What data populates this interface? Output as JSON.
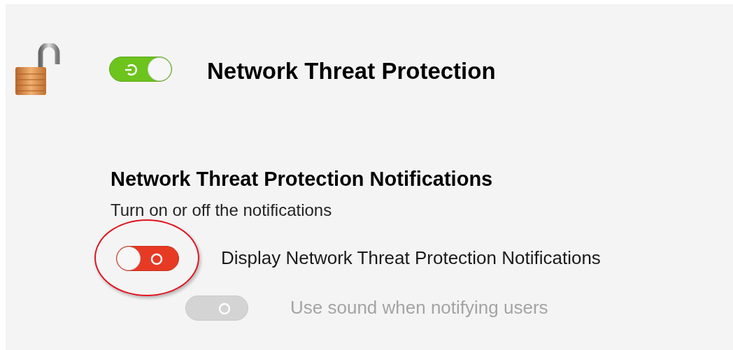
{
  "main_setting": {
    "label": "Network Threat Protection",
    "toggle": {
      "on": true,
      "disabled": false
    }
  },
  "notifications": {
    "heading": "Network Threat Protection Notifications",
    "description": "Turn on or off the notifications",
    "options": [
      {
        "label": "Display Network Threat Protection Notifications",
        "on": false,
        "disabled": false,
        "highlighted": true
      },
      {
        "label": "Use sound when notifying users",
        "on": false,
        "disabled": true,
        "highlighted": false
      }
    ]
  }
}
